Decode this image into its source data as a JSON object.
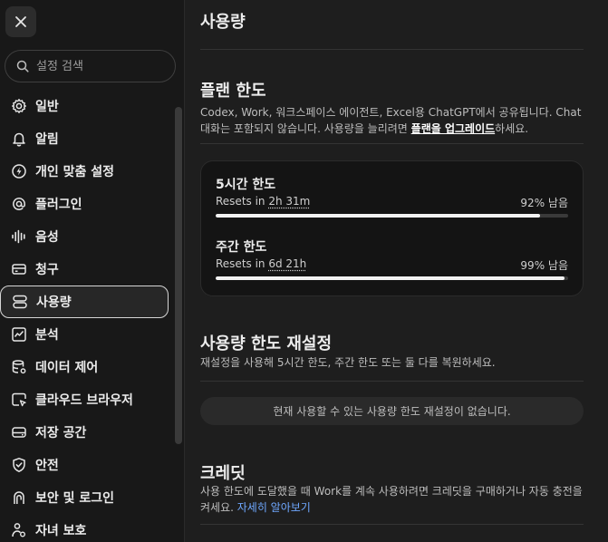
{
  "sidebar": {
    "search_placeholder": "설정 검색",
    "items": [
      {
        "label": "일반",
        "icon": "gear-icon"
      },
      {
        "label": "알림",
        "icon": "bell-icon"
      },
      {
        "label": "개인 맞춤 설정",
        "icon": "personalize-icon"
      },
      {
        "label": "플러그인",
        "icon": "at-icon"
      },
      {
        "label": "음성",
        "icon": "voice-icon"
      },
      {
        "label": "청구",
        "icon": "card-icon"
      },
      {
        "label": "사용량",
        "icon": "usage-icon"
      },
      {
        "label": "분석",
        "icon": "analytics-icon"
      },
      {
        "label": "데이터 제어",
        "icon": "database-icon"
      },
      {
        "label": "클라우드 브라우저",
        "icon": "cloud-browser-icon"
      },
      {
        "label": "저장 공간",
        "icon": "storage-icon"
      },
      {
        "label": "안전",
        "icon": "shield-icon"
      },
      {
        "label": "보안 및 로그인",
        "icon": "lock-icon"
      },
      {
        "label": "자녀 보호",
        "icon": "family-icon"
      }
    ],
    "active_index": 6
  },
  "main": {
    "page_title": "사용량",
    "plan": {
      "title": "플랜 한도",
      "desc_before": "Codex, Work, 워크스페이스 에이전트, Excel용 ChatGPT에서 공유됩니다. Chat 대화는 포함되지 않습니다. 사용량을 늘리려면 ",
      "desc_link": "플랜을 업그레이드",
      "desc_after": "하세요."
    },
    "limits": [
      {
        "title": "5시간 한도",
        "resets_prefix": "Resets in ",
        "resets_value": "2h 31m",
        "remaining": "92% 남음",
        "fraction": 0.92
      },
      {
        "title": "주간 한도",
        "resets_prefix": "Resets in ",
        "resets_value": "6d 21h",
        "remaining": "99% 남음",
        "fraction": 0.99
      }
    ],
    "reset": {
      "title": "사용량 한도 재설정",
      "desc": "재설정을 사용해 5시간 한도, 주간 한도 또는 둘 다를 복원하세요.",
      "empty": "현재 사용할 수 있는 사용량 한도 재설정이 없습니다."
    },
    "credits": {
      "title": "크레딧",
      "desc": "사용 한도에 도달했을 때 Work를 계속 사용하려면 크레딧을 구매하거나 자동 충전을 켜세요. ",
      "link": "자세히 알아보기"
    }
  }
}
